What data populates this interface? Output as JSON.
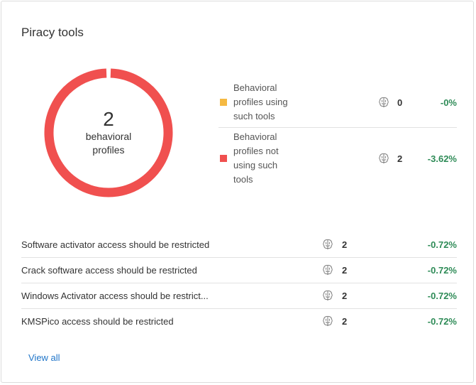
{
  "card": {
    "title": "Piracy tools"
  },
  "chart_data": {
    "type": "pie",
    "title": "",
    "categories": [
      "Behavioral profiles using such tools",
      "Behavioral profiles not using such tools"
    ],
    "values": [
      0,
      2
    ],
    "colors": [
      "#f5b942",
      "#f0504f"
    ],
    "center_value": "2",
    "center_label": "behavioral profiles"
  },
  "legend": {
    "items": [
      {
        "label_lines": [
          "Behavioral",
          "profiles using",
          "such tools"
        ],
        "count": "0",
        "change": "-0%",
        "color": "#f5b942",
        "icon": "brain-icon"
      },
      {
        "label_lines": [
          "Behavioral",
          "profiles not",
          "using such",
          "tools"
        ],
        "count": "2",
        "change": "-3.62%",
        "color": "#f0504f",
        "icon": "brain-icon"
      }
    ]
  },
  "rules": [
    {
      "name": "Software activator access should be restricted",
      "count": "2",
      "change": "-0.72%",
      "icon": "brain-icon"
    },
    {
      "name": "Crack software access should be restricted",
      "count": "2",
      "change": "-0.72%",
      "icon": "brain-icon"
    },
    {
      "name": "Windows Activator access should be restrict...",
      "count": "2",
      "change": "-0.72%",
      "icon": "brain-icon"
    },
    {
      "name": "KMSPico access should be restricted",
      "count": "2",
      "change": "-0.72%",
      "icon": "brain-icon"
    }
  ],
  "footer": {
    "view_all_label": "View all"
  }
}
